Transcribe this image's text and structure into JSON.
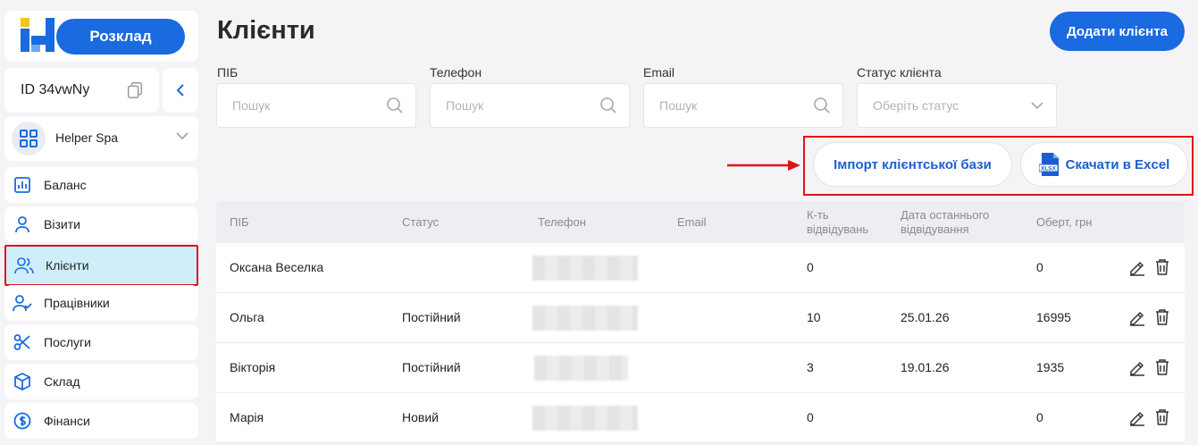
{
  "sidebar": {
    "schedule_label": "Розклад",
    "account_id": "ID 34vwNy",
    "org_name": "Helper Spa",
    "nav": [
      {
        "label": "Баланс",
        "icon": "chart-bar-icon"
      },
      {
        "label": "Візити",
        "icon": "user-icon"
      },
      {
        "label": "Клієнти",
        "icon": "users-icon"
      },
      {
        "label": "Працівники",
        "icon": "user-check-icon"
      },
      {
        "label": "Послуги",
        "icon": "scissors-icon"
      },
      {
        "label": "Склад",
        "icon": "box-icon"
      },
      {
        "label": "Фінанси",
        "icon": "dollar-icon"
      }
    ]
  },
  "page": {
    "title": "Клієнти",
    "add_label": "Додати клієнта"
  },
  "filters": {
    "name_label": "ПІБ",
    "name_placeholder": "Пошук",
    "phone_label": "Телефон",
    "phone_placeholder": "Пошук",
    "email_label": "Email",
    "email_placeholder": "Пошук",
    "status_label": "Статус клієнта",
    "status_placeholder": "Оберіть статус"
  },
  "actions": {
    "import_label": "Імпорт клієнтської бази",
    "excel_label": "Скачати в Excel",
    "excel_badge": "XLSX"
  },
  "table": {
    "headers": {
      "name": "ПІБ",
      "status": "Статус",
      "phone": "Телефон",
      "email": "Email",
      "visits_1": "К-ть",
      "visits_2": "відвідувань",
      "last_1": "Дата останнього",
      "last_2": "відвідування",
      "turnover": "Оберт, грн"
    },
    "rows": [
      {
        "name": "Оксана Веселка",
        "status": "",
        "visits": "0",
        "last": "",
        "turnover": "0"
      },
      {
        "name": "Ольга",
        "status": "Постійний",
        "visits": "10",
        "last": "25.01.26",
        "turnover": "16995"
      },
      {
        "name": "Вікторія",
        "status": "Постійний",
        "visits": "3",
        "last": "19.01.26",
        "turnover": "1935"
      },
      {
        "name": "Марія",
        "status": "Новий",
        "visits": "0",
        "last": "",
        "turnover": "0"
      }
    ]
  },
  "colors": {
    "accent": "#1a6ae0",
    "highlight": "#e0121a",
    "active_bg": "#cfeefa"
  }
}
